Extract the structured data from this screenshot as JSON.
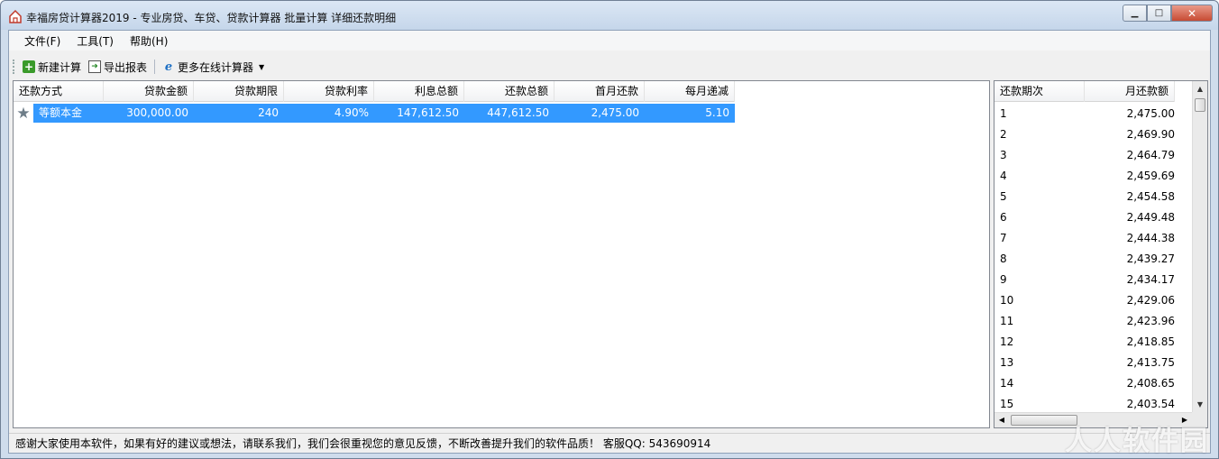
{
  "window": {
    "title": "幸福房贷计算器2019 - 专业房贷、车贷、贷款计算器 批量计算 详细还款明细"
  },
  "menu": [
    "文件(F)",
    "工具(T)",
    "帮助(H)"
  ],
  "toolbar": {
    "new_calc": "新建计算",
    "export_report": "导出报表",
    "more_online": "更多在线计算器"
  },
  "main_list": {
    "columns": [
      "还款方式",
      "贷款金额",
      "贷款期限",
      "贷款利率",
      "利息总额",
      "还款总额",
      "首月还款",
      "每月递减"
    ],
    "rows": [
      [
        "等额本金",
        "300,000.00",
        "240",
        "4.90%",
        "147,612.50",
        "447,612.50",
        "2,475.00",
        "5.10"
      ]
    ]
  },
  "side_list": {
    "columns": [
      "还款期次",
      "月还款额"
    ],
    "rows": [
      [
        "1",
        "2,475.00"
      ],
      [
        "2",
        "2,469.90"
      ],
      [
        "3",
        "2,464.79"
      ],
      [
        "4",
        "2,459.69"
      ],
      [
        "5",
        "2,454.58"
      ],
      [
        "6",
        "2,449.48"
      ],
      [
        "7",
        "2,444.38"
      ],
      [
        "8",
        "2,439.27"
      ],
      [
        "9",
        "2,434.17"
      ],
      [
        "10",
        "2,429.06"
      ],
      [
        "11",
        "2,423.96"
      ],
      [
        "12",
        "2,418.85"
      ],
      [
        "13",
        "2,413.75"
      ],
      [
        "14",
        "2,408.65"
      ],
      [
        "15",
        "2,403.54"
      ]
    ]
  },
  "status": "感谢大家使用本软件，如果有好的建议或想法，请联系我们，我们会很重视您的意见反馈，不断改善提升我们的软件品质！ 客服QQ: 543690914",
  "watermark": "人人软件园",
  "colors": {
    "selection": "#3399ff",
    "title_bg": "#cfdcec"
  }
}
